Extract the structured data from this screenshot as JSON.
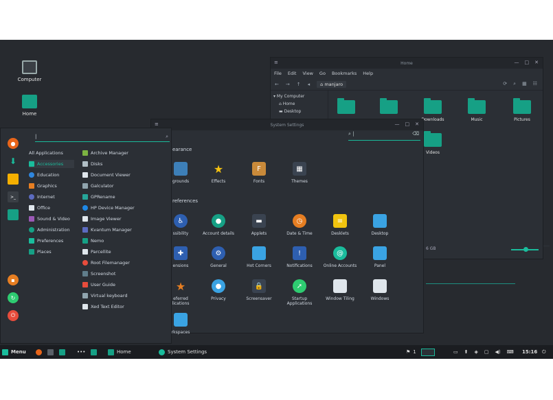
{
  "desktop": {
    "icons": [
      {
        "label": "Computer"
      },
      {
        "label": "Home"
      }
    ]
  },
  "file_manager": {
    "title": "Home",
    "menus": [
      "File",
      "Edit",
      "View",
      "Go",
      "Bookmarks",
      "Help"
    ],
    "breadcrumb": "manjaro",
    "sidebar": [
      "My Computer",
      "Home",
      "Desktop"
    ],
    "folders": [
      "",
      "",
      "Downloads",
      "Music",
      "Pictures",
      "Videos"
    ],
    "status": "6 GB"
  },
  "system_settings": {
    "title": "System Settings",
    "section_appearance": "earance",
    "section_preferences": "references",
    "appearance": [
      "grounds",
      "Effects",
      "Fonts",
      "Themes"
    ],
    "preferences_row1": [
      "ssibility",
      "Account details",
      "Applets",
      "Date & Time",
      "Desklets",
      "Desktop"
    ],
    "preferences_row2": [
      "ensions",
      "General",
      "Hot Corners",
      "Notifications",
      "Online Accounts",
      "Panel"
    ],
    "preferences_row3": [
      "eferred\nlications",
      "Privacy",
      "Screensaver",
      "Startup Applications",
      "Window Tiling",
      "Windows"
    ],
    "preferences_row4": [
      "rkspaces"
    ]
  },
  "menu": {
    "search_value": "",
    "categories": [
      "All Applications",
      "Accessories",
      "Education",
      "Graphics",
      "Internet",
      "Office",
      "Sound & Video",
      "Administration",
      "Preferences",
      "Places"
    ],
    "apps": [
      "Archive Manager",
      "Disks",
      "Document Viewer",
      "Galculator",
      "GPRename",
      "HP Device Manager",
      "Image Viewer",
      "Kvantum Manager",
      "Nemo",
      "Parcellite",
      "Root Filemanager",
      "Screenshot",
      "User Guide",
      "Virtual keyboard",
      "Xed Text Editor"
    ]
  },
  "panel": {
    "menu_label": "Menu",
    "tasks": [
      "Home",
      "System Settings"
    ],
    "workspace": "1",
    "clock": "15:16"
  },
  "colors": {
    "accent": "#1abc9c",
    "bg": "#2b2f35",
    "panel": "#1b1d21"
  }
}
